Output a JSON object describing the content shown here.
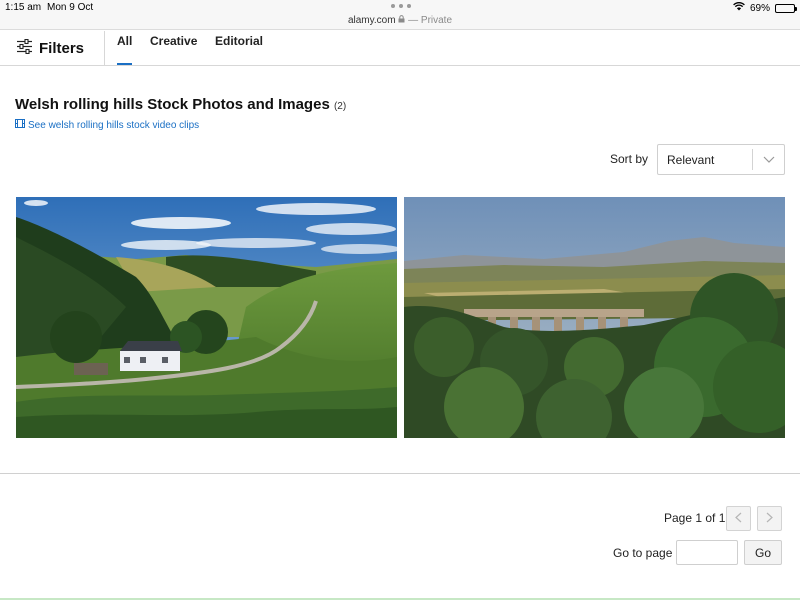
{
  "status_bar": {
    "time": "1:15 am",
    "date": "Mon 9 Oct",
    "url": "alamy.com",
    "private_label": "— Private",
    "battery": "69%",
    "battery_level": 0.69
  },
  "filter_bar": {
    "filters_label": "Filters",
    "tabs": [
      {
        "label": "All",
        "active": true
      },
      {
        "label": "Creative",
        "active": false
      },
      {
        "label": "Editorial",
        "active": false
      }
    ]
  },
  "results": {
    "title": "Welsh rolling hills Stock Photos and Images",
    "count": "(2)",
    "video_link": "See welsh rolling hills stock video clips"
  },
  "sort": {
    "label": "Sort by",
    "selected": "Relevant"
  },
  "images": [
    {
      "subject": "valley with white cottage and winding road"
    },
    {
      "subject": "stone viaduct among trees with distant mountains"
    }
  ],
  "pagination": {
    "page_info": "Page 1 of 1",
    "goto_label": "Go to page",
    "goto_value": "",
    "go_button": "Go"
  },
  "colors": {
    "accent": "#1a6fc4",
    "border": "#d7d7d7"
  }
}
